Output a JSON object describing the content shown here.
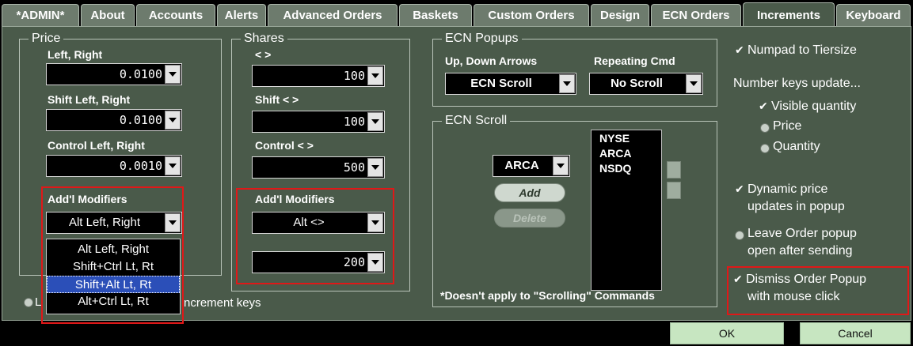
{
  "tabs": [
    "*ADMIN*",
    "About",
    "Accounts",
    "Alerts",
    "Advanced Orders",
    "Baskets",
    "Custom Orders",
    "Design",
    "ECN Orders",
    "Increments",
    "Keyboard"
  ],
  "active_tab": "Increments",
  "price": {
    "title": "Price",
    "lr_label": "Left, Right",
    "lr_value": "0.0100",
    "shift_label": "Shift  Left, Right",
    "shift_value": "0.0100",
    "ctrl_label": "Control  Left, Right",
    "ctrl_value": "0.0010",
    "addl_label": "Add'l Modifiers",
    "addl_value": "Alt Left, Right",
    "dropdown_options": [
      "Alt Left, Right",
      "Shift+Ctrl Lt, Rt",
      "Shift+Alt Lt, Rt",
      "Alt+Ctrl Lt, Rt"
    ],
    "selected_option": "Shift+Alt Lt, Rt"
  },
  "shares": {
    "title": "Shares",
    "lr_label": "< >",
    "lr_value": "100",
    "shift_label": "Shift  < >",
    "shift_value": "100",
    "ctrl_label": "Control  < >",
    "ctrl_value": "500",
    "addl_label": "Add'l Modifiers",
    "addl_value": "Alt <>",
    "addl_amount": "200"
  },
  "increment_keys_label": "ncrement keys",
  "increment_keys_prefix": "L",
  "ecn_popups": {
    "title": "ECN Popups",
    "updown_label": "Up, Down Arrows",
    "updown_value": "ECN Scroll",
    "repeat_label": "Repeating Cmd",
    "repeat_value": "No Scroll"
  },
  "ecn_scroll": {
    "title": "ECN Scroll",
    "select_value": "ARCA",
    "add_label": "Add",
    "delete_label": "Delete",
    "list": [
      "NYSE",
      "ARCA",
      "NSDQ"
    ],
    "footnote": "*Doesn't apply to \"Scrolling\" Commands"
  },
  "options": {
    "numpad_tiersize": "Numpad to Tiersize",
    "number_keys_update": "Number keys update...",
    "visible_quantity": "Visible quantity",
    "price": "Price",
    "quantity": "Quantity",
    "dynamic_price_1": "Dynamic price",
    "dynamic_price_2": "updates in popup",
    "leave_order_1": "Leave Order popup",
    "leave_order_2": "open after sending",
    "dismiss_1": "Dismiss Order Popup",
    "dismiss_2": "with mouse click"
  },
  "buttons": {
    "ok": "OK",
    "cancel": "Cancel"
  },
  "colors": {
    "panel": "#4a5a4a",
    "highlight": "#e01818",
    "button": "#c7e6c1"
  }
}
